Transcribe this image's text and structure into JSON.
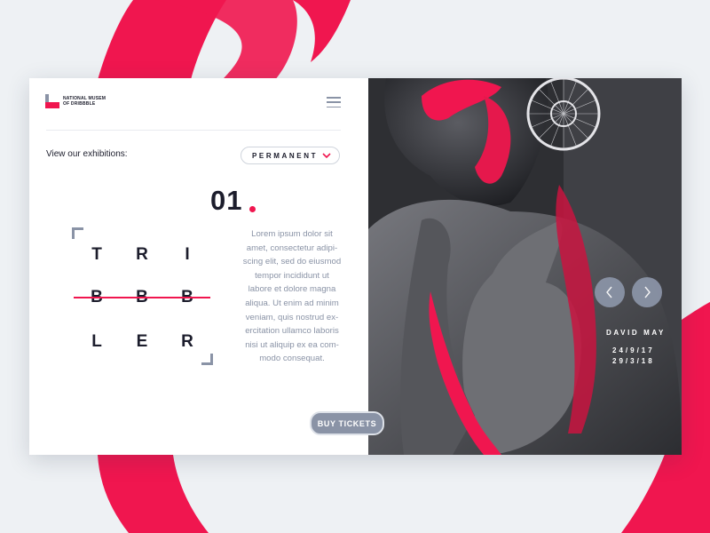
{
  "brand": {
    "name_line1": "NATIONAL MUSEM",
    "name_line2": "OF DRIBBBLE",
    "accent": "#f0164f",
    "dark": "#1c1d2c",
    "muted": "#8a93a6"
  },
  "header": {
    "menu_icon": "hamburger-icon"
  },
  "filter": {
    "label": "View our exhibitions:",
    "selected": "PERMANENT",
    "chevron_icon": "chevron-down-icon"
  },
  "exhibit": {
    "number": "01",
    "letters": [
      "T",
      "R",
      "I",
      "B",
      "B",
      "B",
      "L",
      "E",
      "R"
    ],
    "description": "Lorem ipsum dolor sit\namet, consectetur adipi-\nscing elit, sed do eiusmod\ntempor incididunt ut\nlabore et dolore magna\naliqua. Ut enim ad minim\nveniam, quis nostrud ex-\nercitation ullamco laboris\nnisi ut aliquip ex ea com-\nmodo consequat.",
    "artist": "DAVID MAY",
    "date_start": "24/9/17",
    "date_end": "29/3/18"
  },
  "actions": {
    "buy_label": "BUY TICKETS",
    "prev_icon": "chevron-left-icon",
    "next_icon": "chevron-right-icon"
  }
}
